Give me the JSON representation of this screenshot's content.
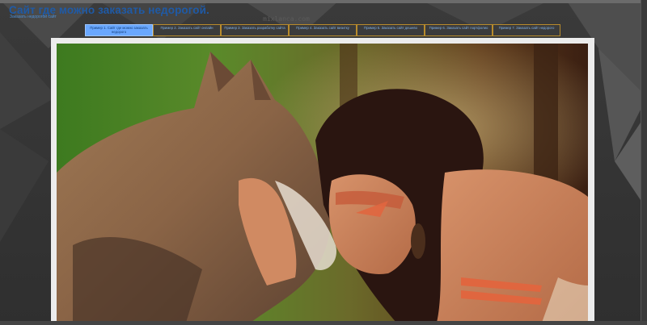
{
  "site": {
    "title": "Сайт где можно заказать недорогой.",
    "subtitle": "Заказать недорогой сайт",
    "watermark": "mixlanca.com"
  },
  "nav": [
    {
      "label": "Пример 1. Сайт где можно заказать недорого",
      "active": true
    },
    {
      "label": "Пример 2. Заказать сайт онлайн",
      "active": false
    },
    {
      "label": "Пример 3. Заказать разработку сайта",
      "active": false
    },
    {
      "label": "Пример 4. Заказать сайт визитку",
      "active": false
    },
    {
      "label": "Пример 5. Заказать сайт дешево",
      "active": false
    },
    {
      "label": "Пример 6. Заказать сайт портфолио",
      "active": false
    },
    {
      "label": "Пример 7. Заказать сайт недорого",
      "active": false
    }
  ],
  "colors": {
    "title": "#1f5aa6",
    "nav_active_bg": "#6aa8ff",
    "nav_border": "#b88b2c",
    "frame": "#ececec"
  }
}
